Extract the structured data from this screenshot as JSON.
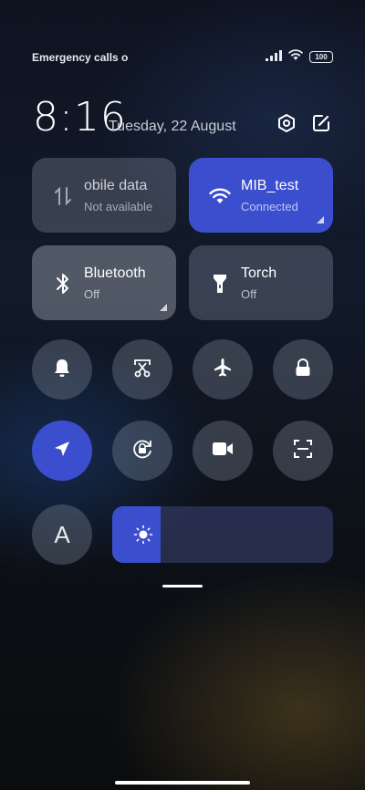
{
  "status_bar": {
    "left_text": "Emergency calls o",
    "battery": "100"
  },
  "header": {
    "time": "8:16",
    "date": "Tuesday, 22 August"
  },
  "tiles": [
    {
      "id": "mobile-data",
      "title": "obile data",
      "subtitle": "Not available",
      "icon": "mobile-data-icon"
    },
    {
      "id": "wifi",
      "title": "MIB_test",
      "subtitle": "Connected",
      "icon": "wifi-icon"
    },
    {
      "id": "bluetooth",
      "title": "Bluetooth",
      "subtitle": "Off",
      "icon": "bluetooth-icon"
    },
    {
      "id": "torch",
      "title": "Torch",
      "subtitle": "Off",
      "icon": "torch-icon"
    }
  ],
  "toggles": [
    {
      "id": "silent",
      "icon": "bell-icon",
      "active": false
    },
    {
      "id": "screenshot",
      "icon": "scissors-icon",
      "active": false
    },
    {
      "id": "airplane",
      "icon": "airplane-icon",
      "active": false
    },
    {
      "id": "lock",
      "icon": "lock-icon",
      "active": false
    },
    {
      "id": "location",
      "icon": "location-arrow-icon",
      "active": true
    },
    {
      "id": "rotation-lock",
      "icon": "rotation-lock-icon",
      "active": false
    },
    {
      "id": "screen-record",
      "icon": "video-camera-icon",
      "active": false
    },
    {
      "id": "scanner",
      "icon": "scanner-icon",
      "active": false
    }
  ],
  "font_toggle": {
    "label": "A"
  },
  "brightness": {
    "level": 0.22,
    "icon": "sun-icon"
  },
  "colors": {
    "accent": "#3b4fce"
  }
}
